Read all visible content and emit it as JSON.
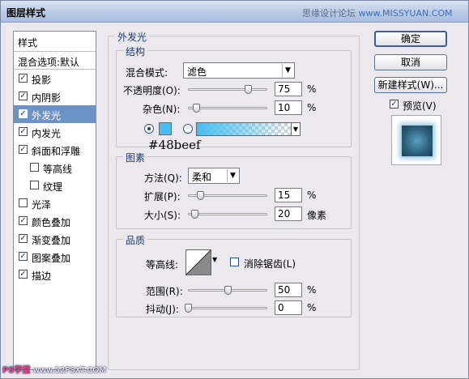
{
  "window": {
    "title": "图层样式",
    "watermark_top_text": "思缘设计论坛",
    "watermark_top_url": "www.MISSYUAN.COM"
  },
  "style_list": {
    "header": "样式",
    "blend_options": "混合选项:默认",
    "items": [
      {
        "label": "投影",
        "checked": true
      },
      {
        "label": "内阴影",
        "checked": true
      },
      {
        "label": "外发光",
        "checked": true,
        "selected": true
      },
      {
        "label": "内发光",
        "checked": true
      },
      {
        "label": "斜面和浮雕",
        "checked": true
      },
      {
        "label": "等高线",
        "checked": false,
        "sub": true
      },
      {
        "label": "纹理",
        "checked": false,
        "sub": true
      },
      {
        "label": "光泽",
        "checked": false
      },
      {
        "label": "颜色叠加",
        "checked": true
      },
      {
        "label": "渐变叠加",
        "checked": true
      },
      {
        "label": "图案叠加",
        "checked": true
      },
      {
        "label": "描边",
        "checked": true
      }
    ]
  },
  "buttons": {
    "ok": "确定",
    "cancel": "取消",
    "new_style": "新建样式(W)...",
    "preview_label": "预览(V)",
    "preview_checked": true
  },
  "outer_glow": {
    "title": "外发光",
    "structure": {
      "title": "结构",
      "blend_mode_label": "混合模式:",
      "blend_mode_value": "滤色",
      "opacity_label": "不透明度(O):",
      "opacity_value": "75",
      "opacity_unit": "%",
      "opacity_level": 0.75,
      "noise_label": "杂色(N):",
      "noise_value": "10",
      "noise_unit": "%",
      "noise_level": 0.1,
      "color_hex": "#48beef",
      "color_note": "#48beef"
    },
    "elements": {
      "title": "图素",
      "technique_label": "方法(Q):",
      "technique_value": "柔和",
      "spread_label": "扩展(P):",
      "spread_value": "15",
      "spread_unit": "%",
      "spread_level": 0.15,
      "size_label": "大小(S):",
      "size_value": "20",
      "size_unit": "像素",
      "size_level": 0.08
    },
    "quality": {
      "title": "品质",
      "contour_label": "等高线:",
      "anti_alias_label": "消除锯齿(L)",
      "anti_alias_checked": false,
      "range_label": "范围(R):",
      "range_value": "50",
      "range_unit": "%",
      "range_level": 0.5,
      "jitter_label": "抖动(J):",
      "jitter_value": "0",
      "jitter_unit": "%",
      "jitter_level": 0.0
    }
  },
  "watermark_bottom": {
    "brand": "PS学堂",
    "url": "www.52PSXT.COM"
  }
}
